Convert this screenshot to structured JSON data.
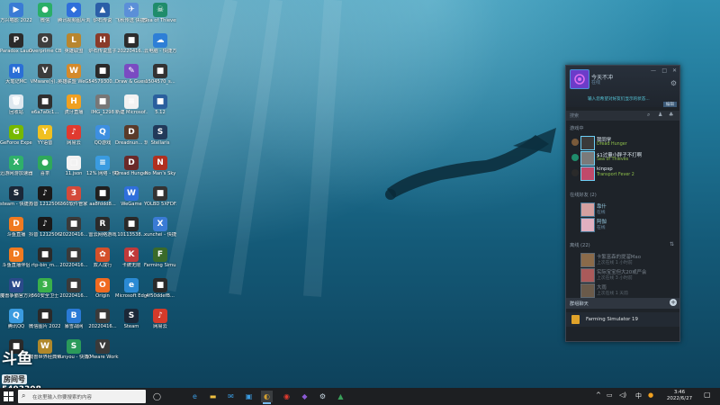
{
  "desktop": {
    "icons": [
      {
        "label": "万兴喵影 2022",
        "color": "#3a7bd5",
        "glyph": "▶"
      },
      {
        "label": "微信",
        "color": "#2aae67",
        "glyph": "●"
      },
      {
        "label": "腾讯视频图片浏览",
        "color": "#2f6fdb",
        "glyph": "◆"
      },
      {
        "label": "炉石传说",
        "color": "#2b5fa8",
        "glyph": "▲"
      },
      {
        "label": "飞秋传送 快捷方式 (2)",
        "color": "#5b8fd8",
        "glyph": "✈"
      },
      {
        "label": "Sea of Thieves",
        "color": "#1f8c6b",
        "glyph": "☠"
      },
      {
        "label": "Paradox Launcher v2",
        "color": "#2b2b2b",
        "glyph": "P"
      },
      {
        "label": "Overprime CBT (Clos...",
        "color": "#3e3e3e",
        "glyph": "O"
      },
      {
        "label": "英雄联盟",
        "color": "#b8862f",
        "glyph": "L"
      },
      {
        "label": "炉石传说盒子",
        "color": "#8a3b2a",
        "glyph": "H"
      },
      {
        "label": "20220416...",
        "color": "#2d2d2d",
        "glyph": "■"
      },
      {
        "label": "云电脑 - 快捷方式",
        "color": "#2e7fd6",
        "glyph": "☁"
      },
      {
        "label": "大笔记MC",
        "color": "#2a6fd6",
        "glyph": "M"
      },
      {
        "label": "VMware(引...",
        "color": "#3c3c3c",
        "glyph": "V"
      },
      {
        "label": "英雄联盟 WeGame版",
        "color": "#d48a2b",
        "glyph": "W"
      },
      {
        "label": "54579300...",
        "color": "#2a2a2a",
        "glyph": "■"
      },
      {
        "label": "Draw & Guess",
        "color": "#7a4bc2",
        "glyph": "✎"
      },
      {
        "label": "1504570_s...",
        "color": "#333333",
        "glyph": "■"
      },
      {
        "label": "回收站",
        "color": "#dfe8ef",
        "glyph": "🗑"
      },
      {
        "label": "e6a7a0c1...",
        "color": "#2f2f2f",
        "glyph": "■"
      },
      {
        "label": "虎牙直播",
        "color": "#f0a020",
        "glyph": "H"
      },
      {
        "label": "IMG_1298",
        "color": "#777777",
        "glyph": "■"
      },
      {
        "label": "新建 Microsof...",
        "color": "#f2f2f2",
        "glyph": "≡"
      },
      {
        "label": "5.12",
        "color": "#2a5f9e",
        "glyph": "■"
      },
      {
        "label": "GeForce Experience",
        "color": "#76b900",
        "glyph": "G"
      },
      {
        "label": "YY语音",
        "color": "#f0c020",
        "glyph": "Y"
      },
      {
        "label": "网易云",
        "color": "#e03a2f",
        "glyph": "♪"
      },
      {
        "label": "QQ游戏",
        "color": "#3d8fe0",
        "glyph": "Q"
      },
      {
        "label": "Dreadnun... 玩具 Holl...",
        "color": "#5a3b2a",
        "glyph": "D"
      },
      {
        "label": "Stellaris",
        "color": "#223a5a",
        "glyph": "S"
      },
      {
        "label": "迅游网游加速器",
        "color": "#2fb06a",
        "glyph": "X"
      },
      {
        "label": "喜茶",
        "color": "#2fa85a",
        "glyph": "●"
      },
      {
        "label": "11.json",
        "color": "#f2f2f2",
        "glyph": "□"
      },
      {
        "label": "12% 网络 - 快捷方式",
        "color": "#3a9be0",
        "glyph": "≡"
      },
      {
        "label": "Dread Hunger",
        "color": "#6a2a2a",
        "glyph": "D"
      },
      {
        "label": "No Man's Sky",
        "color": "#b03020",
        "glyph": "N"
      },
      {
        "label": "steam - 快捷方式",
        "color": "#1b2838",
        "glyph": "S"
      },
      {
        "label": "抖音 12125064...",
        "color": "#1a1a1a",
        "glyph": "♪"
      },
      {
        "label": "360软件管家",
        "color": "#d44a3a",
        "glyph": "3"
      },
      {
        "label": "aa8fddd8...",
        "color": "#202020",
        "glyph": "■"
      },
      {
        "label": "WeGame",
        "color": "#2f6fdb",
        "glyph": "W"
      },
      {
        "label": "YOLBD 5XFDF...",
        "color": "#333333",
        "glyph": "■"
      },
      {
        "label": "斗鱼直播",
        "color": "#f07a20",
        "glyph": "D"
      },
      {
        "label": "抖音 12125064...",
        "color": "#1a1a1a",
        "glyph": "♪"
      },
      {
        "label": "20220416...",
        "color": "#3a3a3a",
        "glyph": "■"
      },
      {
        "label": "雷云网络游戏",
        "color": "#2b2b2b",
        "glyph": "R"
      },
      {
        "label": "10113538...",
        "color": "#2a2a2a",
        "glyph": "■"
      },
      {
        "label": "xunchei - 快捷方式",
        "color": "#3a7bd5",
        "glyph": "X"
      },
      {
        "label": "斗鱼直播伴侣",
        "color": "#f07a20",
        "glyph": "D"
      },
      {
        "label": "rtp-bin_m...",
        "color": "#2a2a2a",
        "glyph": "■"
      },
      {
        "label": "20220416...",
        "color": "#3a3a3a",
        "glyph": "■"
      },
      {
        "label": "双人成行",
        "color": "#d4502a",
        "glyph": "✿"
      },
      {
        "label": "卡牌无限",
        "color": "#c03a3a",
        "glyph": "K"
      },
      {
        "label": "Farming Simulat...",
        "color": "#3a6a2a",
        "glyph": "F"
      },
      {
        "label": "魔兽争霸官方对战平台",
        "color": "#2a4a8a",
        "glyph": "W"
      },
      {
        "label": "360安全卫士",
        "color": "#3ab04a",
        "glyph": "3"
      },
      {
        "label": "20220416...",
        "color": "#3a3a3a",
        "glyph": "■"
      },
      {
        "label": "Origin",
        "color": "#f06a20",
        "glyph": "O"
      },
      {
        "label": "Microsoft Edge",
        "color": "#2a8ad4",
        "glyph": "e"
      },
      {
        "label": "4f50ddefB...",
        "color": "#2a2a2a",
        "glyph": "■"
      },
      {
        "label": "腾讯QQ",
        "color": "#3a9be0",
        "glyph": "Q"
      },
      {
        "label": "微信图片 2022032...",
        "color": "#2a2a2a",
        "glyph": "■"
      },
      {
        "label": "暴雪战网",
        "color": "#2a7ad6",
        "glyph": "B"
      },
      {
        "label": "20220416...",
        "color": "#3a3a3a",
        "glyph": "■"
      },
      {
        "label": "Steam",
        "color": "#1b2838",
        "glyph": "S"
      },
      {
        "label": "网易云",
        "color": "#d43a2a",
        "glyph": "♪"
      },
      {
        "label": "",
        "color": "#2a2a2a",
        "glyph": "■"
      },
      {
        "label": "魔兽世界经典怀旧服",
        "color": "#b0882a",
        "glyph": "W"
      },
      {
        "label": "sunyou - 快捷方式",
        "color": "#2a9a5a",
        "glyph": "S"
      },
      {
        "label": "VMware Workstat...",
        "color": "#3a3a3a",
        "glyph": "V"
      }
    ]
  },
  "watermark": {
    "logo": "斗鱼",
    "sub": "房间号",
    "room": "5493308"
  },
  "friends_panel": {
    "username": "今天不冲",
    "status": "在线",
    "status_message": "输入您希望对好友们显示的状态...",
    "edit_label": "编辑",
    "search_label": "搜索",
    "sections": [
      {
        "title": "游戏中"
      },
      {
        "title": "在线好友 (2)"
      },
      {
        "title": "离线 (22)"
      }
    ],
    "in_game": [
      {
        "name": "我同学",
        "game": "Dread Hunger",
        "avatar_color": "#3a3a3a",
        "game_icon_color": "#7a5a3a"
      },
      {
        "name": "$1过量小胖子不打啊",
        "game": "Sea of Thieves",
        "avatar_color": "#7a7a7a",
        "game_icon_color": "#1f8c6b"
      },
      {
        "name": "kinpsp",
        "game": "Transport Fever 2",
        "avatar_color": "#c04a6a",
        "game_icon_color": "#2a2a2a"
      }
    ],
    "online": [
      {
        "name": "靠什",
        "game": "在线",
        "avatar_color": "#d4a0a0"
      },
      {
        "name": "阿伽",
        "game": "在线",
        "avatar_color": "#e0b0c0"
      }
    ],
    "offline": [
      {
        "name": "卡繁富森的提溜Mao",
        "game": "上次在线 1 小时前",
        "avatar_color": "#8a6a4a"
      },
      {
        "name": "实际宝宝但大20或严会",
        "game": "上次在线 3 小时前",
        "avatar_color": "#aa5a5a"
      },
      {
        "name": "大雨",
        "game": "上次在线 1 天前",
        "avatar_color": "#6a5a4a"
      }
    ],
    "group_bar_label": "群组聊天",
    "group_game": "Farming Simulator 19"
  },
  "taskbar": {
    "search_placeholder": "在这里输入你要搜索的内容",
    "time": "3:46",
    "date": "2022/6/27",
    "apps": [
      {
        "name": "task-view",
        "glyph": "◯",
        "color": "#e8e8e8"
      },
      {
        "name": "edge",
        "glyph": "e",
        "color": "#3a9be0"
      },
      {
        "name": "file-explorer",
        "glyph": "▬",
        "color": "#f0c040"
      },
      {
        "name": "mail",
        "glyph": "✉",
        "color": "#3a9be0"
      },
      {
        "name": "store",
        "glyph": "▣",
        "color": "#3a9be0"
      },
      {
        "name": "cloud-pc",
        "glyph": "◐",
        "color": "#d4a030"
      },
      {
        "name": "netease",
        "glyph": "◉",
        "color": "#e03a2f"
      },
      {
        "name": "game-app",
        "glyph": "◆",
        "color": "#8a5ad4"
      },
      {
        "name": "steam",
        "glyph": "⚙",
        "color": "#c7d5e0"
      },
      {
        "name": "farming",
        "glyph": "▲",
        "color": "#3aa05a"
      }
    ]
  }
}
